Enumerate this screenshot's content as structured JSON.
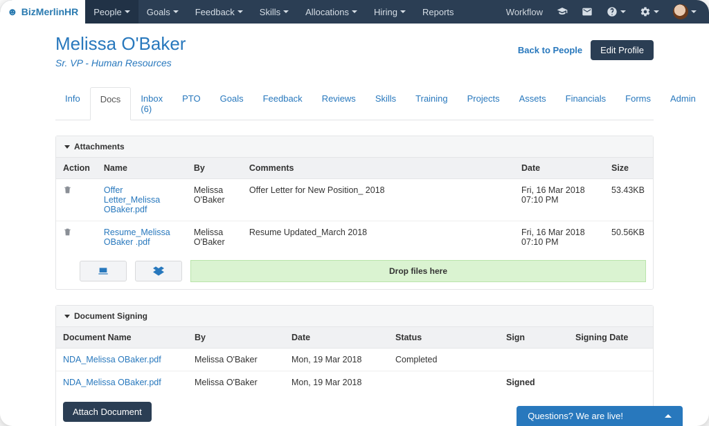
{
  "brand": "BizMerlinHR",
  "nav": {
    "left": [
      {
        "label": "People",
        "caret": true,
        "active": true
      },
      {
        "label": "Goals",
        "caret": true
      },
      {
        "label": "Feedback",
        "caret": true
      },
      {
        "label": "Skills",
        "caret": true
      },
      {
        "label": "Allocations",
        "caret": true
      },
      {
        "label": "Hiring",
        "caret": true
      },
      {
        "label": "Reports",
        "caret": false
      }
    ],
    "right_text": "Workflow"
  },
  "person": {
    "name": "Melissa O'Baker",
    "title": "Sr. VP - Human Resources",
    "back_link": "Back to People",
    "edit_button": "Edit Profile"
  },
  "tabs": [
    "Info",
    "Docs",
    "Inbox (6)",
    "PTO",
    "Goals",
    "Feedback",
    "Reviews",
    "Skills",
    "Training",
    "Projects",
    "Assets",
    "Financials",
    "Forms",
    "Admin"
  ],
  "active_tab_index": 1,
  "attachments": {
    "panel_title": "Attachments",
    "dropzone": "Drop files here",
    "columns": [
      "Action",
      "Name",
      "By",
      "Comments",
      "Date",
      "Size"
    ],
    "rows": [
      {
        "name": "Offer Letter_Melissa OBaker.pdf",
        "by": "Melissa O'Baker",
        "comments": "Offer Letter for New Position_ 2018",
        "date": "Fri, 16 Mar 2018 07:10 PM",
        "size": "53.43KB"
      },
      {
        "name": "Resume_Melissa OBaker .pdf",
        "by": "Melissa O'Baker",
        "comments": "Resume Updated_March 2018",
        "date": "Fri, 16 Mar 2018 07:10 PM",
        "size": "50.56KB"
      }
    ]
  },
  "signing": {
    "panel_title": "Document Signing",
    "attach_button": "Attach Document",
    "columns": [
      "Document Name",
      "By",
      "Date",
      "Status",
      "Sign",
      "Signing Date"
    ],
    "rows": [
      {
        "doc": "NDA_Melissa OBaker.pdf",
        "by": "Melissa O'Baker",
        "date": "Mon, 19 Mar 2018",
        "status": "Completed",
        "sign": "",
        "signing_date": ""
      },
      {
        "doc": "NDA_Melissa OBaker.pdf",
        "by": "Melissa O'Baker",
        "date": "Mon, 19 Mar 2018",
        "status": "",
        "sign": "Signed",
        "signing_date": ""
      }
    ]
  },
  "chat": "Questions? We are live!"
}
